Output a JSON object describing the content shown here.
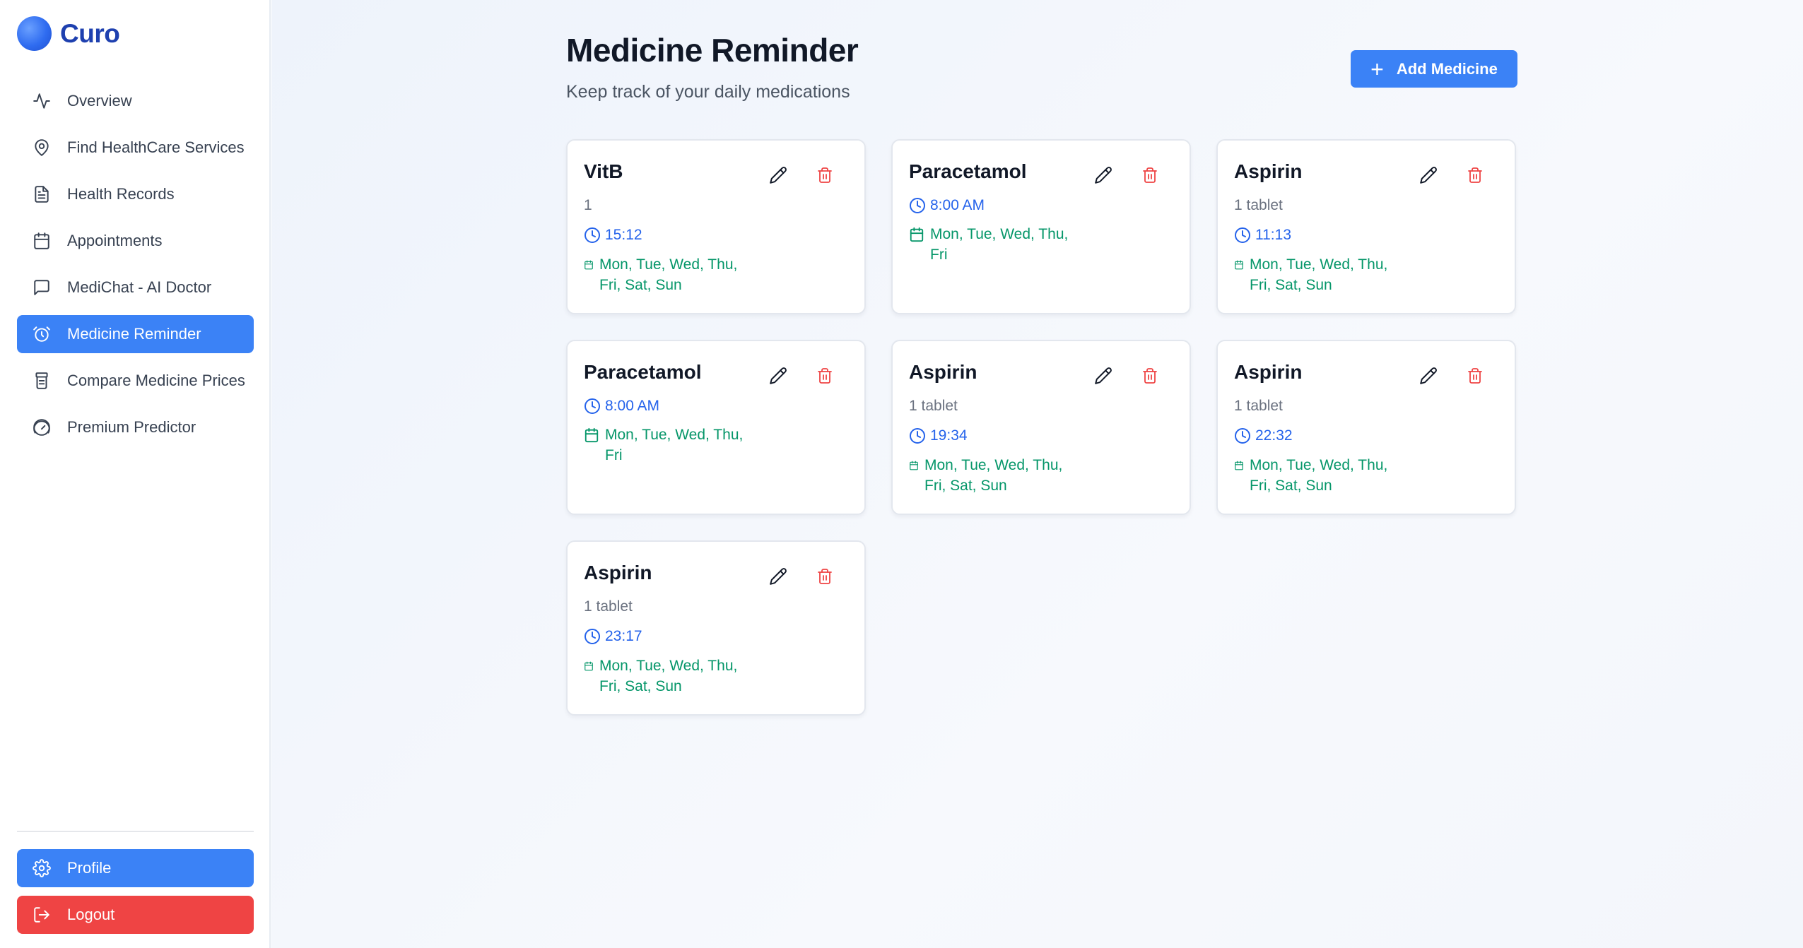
{
  "app": {
    "name": "Curo"
  },
  "sidebar": {
    "items": [
      {
        "label": "Overview",
        "icon": "activity-icon",
        "active": false
      },
      {
        "label": "Find HealthCare Services",
        "icon": "map-pin-icon",
        "active": false
      },
      {
        "label": "Health Records",
        "icon": "file-text-icon",
        "active": false
      },
      {
        "label": "Appointments",
        "icon": "calendar-icon",
        "active": false
      },
      {
        "label": "MediChat - AI Doctor",
        "icon": "chat-icon",
        "active": false
      },
      {
        "label": "Medicine Reminder",
        "icon": "alarm-clock-icon",
        "active": true
      },
      {
        "label": "Compare Medicine Prices",
        "icon": "pill-bottle-icon",
        "active": false
      },
      {
        "label": "Premium Predictor",
        "icon": "gauge-icon",
        "active": false
      }
    ],
    "profile_label": "Profile",
    "logout_label": "Logout"
  },
  "main": {
    "title": "Medicine Reminder",
    "subtitle": "Keep track of your daily medications",
    "add_button_label": "Add Medicine"
  },
  "medicines": [
    {
      "name": "VitB",
      "dose": "1",
      "time": "15:12",
      "days_line1": "Mon, Tue, Wed, Thu,",
      "days_line2": "Fri, Sat, Sun"
    },
    {
      "name": "Paracetamol",
      "dose": "",
      "time": "8:00 AM",
      "days_line1": "Mon, Tue, Wed, Thu,",
      "days_line2": "Fri"
    },
    {
      "name": "Aspirin",
      "dose": "1 tablet",
      "time": "11:13",
      "days_line1": "Mon, Tue, Wed, Thu,",
      "days_line2": "Fri, Sat, Sun"
    },
    {
      "name": "Paracetamol",
      "dose": "",
      "time": "8:00 AM",
      "days_line1": "Mon, Tue, Wed, Thu,",
      "days_line2": "Fri"
    },
    {
      "name": "Aspirin",
      "dose": "1 tablet",
      "time": "19:34",
      "days_line1": "Mon, Tue, Wed, Thu,",
      "days_line2": "Fri, Sat, Sun"
    },
    {
      "name": "Aspirin",
      "dose": "1 tablet",
      "time": "22:32",
      "days_line1": "Mon, Tue, Wed, Thu,",
      "days_line2": "Fri, Sat, Sun"
    },
    {
      "name": "Aspirin",
      "dose": "1 tablet",
      "time": "23:17",
      "days_line1": "Mon, Tue, Wed, Thu,",
      "days_line2": "Fri, Sat, Sun"
    }
  ],
  "colors": {
    "accent": "#3b82f6",
    "danger": "#ef4444",
    "time": "#2563eb",
    "days": "#059669"
  }
}
